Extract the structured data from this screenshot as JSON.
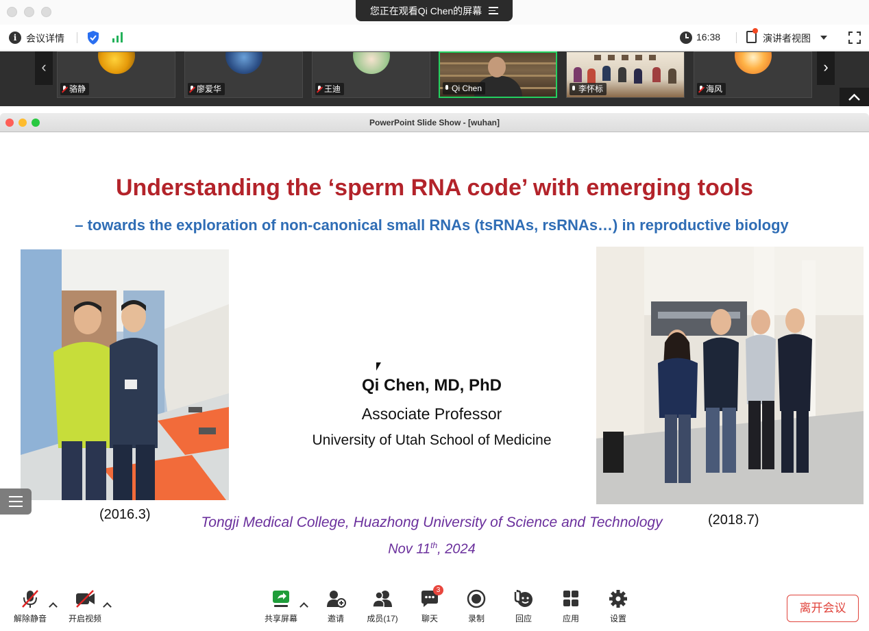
{
  "share_banner": {
    "text": "您正在观看Qi Chen的屏幕"
  },
  "meeting_bar": {
    "details_label": "会议详情",
    "time": "16:38",
    "view_label": "演讲者视图"
  },
  "participants": [
    {
      "name": "骆静",
      "mic": "muted"
    },
    {
      "name": "廖爱华",
      "mic": "muted"
    },
    {
      "name": "王迪",
      "mic": "muted"
    },
    {
      "name": "Qi Chen",
      "mic": "on",
      "active": true
    },
    {
      "name": "李怀标",
      "mic": "on"
    },
    {
      "name": "海风",
      "mic": "muted"
    }
  ],
  "shared_window": {
    "title": "PowerPoint Slide Show - [wuhan]"
  },
  "slide": {
    "title": "Understanding the ‘sperm RNA code’ with emerging tools",
    "subtitle": "– towards the exploration of non-canonical small RNAs (tsRNAs, rsRNAs…) in reproductive biology",
    "speaker_name": "Qi Chen, MD, PhD",
    "speaker_role": "Associate Professor",
    "speaker_institution": "University of Utah School of Medicine",
    "photo_left_caption": "(2016.3)",
    "photo_right_caption": "(2018.7)",
    "venue": "Tongji Medical College, Huazhong University of Science and Technology",
    "date_prefix": "Nov 11",
    "date_sup": "th",
    "date_suffix": ", 2024"
  },
  "toolbar": {
    "unmute": "解除静音",
    "start_video": "开启视频",
    "share_screen": "共享屏幕",
    "invite": "邀请",
    "members": "成员(17)",
    "chat": "聊天",
    "chat_badge": "3",
    "record": "录制",
    "reactions": "回应",
    "apps": "应用",
    "settings": "设置",
    "leave": "离开会议"
  },
  "colors": {
    "slide_title": "#b3232a",
    "slide_subtitle": "#2f6db5",
    "venue": "#6a2f9c",
    "leave": "#e0433b",
    "active_speaker": "#23d160"
  }
}
